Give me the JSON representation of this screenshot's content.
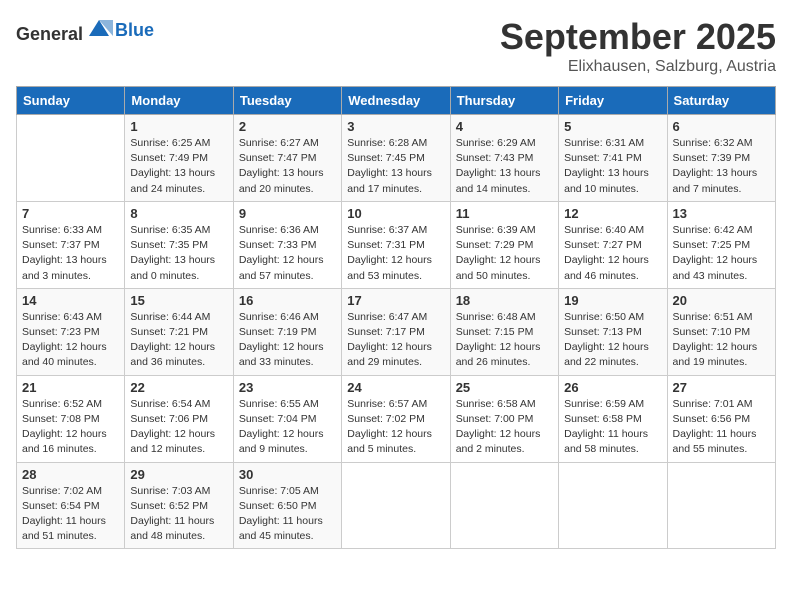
{
  "header": {
    "logo_general": "General",
    "logo_blue": "Blue",
    "month": "September 2025",
    "location": "Elixhausen, Salzburg, Austria"
  },
  "weekdays": [
    "Sunday",
    "Monday",
    "Tuesday",
    "Wednesday",
    "Thursday",
    "Friday",
    "Saturday"
  ],
  "weeks": [
    [
      {
        "day": "",
        "info": ""
      },
      {
        "day": "1",
        "info": "Sunrise: 6:25 AM\nSunset: 7:49 PM\nDaylight: 13 hours\nand 24 minutes."
      },
      {
        "day": "2",
        "info": "Sunrise: 6:27 AM\nSunset: 7:47 PM\nDaylight: 13 hours\nand 20 minutes."
      },
      {
        "day": "3",
        "info": "Sunrise: 6:28 AM\nSunset: 7:45 PM\nDaylight: 13 hours\nand 17 minutes."
      },
      {
        "day": "4",
        "info": "Sunrise: 6:29 AM\nSunset: 7:43 PM\nDaylight: 13 hours\nand 14 minutes."
      },
      {
        "day": "5",
        "info": "Sunrise: 6:31 AM\nSunset: 7:41 PM\nDaylight: 13 hours\nand 10 minutes."
      },
      {
        "day": "6",
        "info": "Sunrise: 6:32 AM\nSunset: 7:39 PM\nDaylight: 13 hours\nand 7 minutes."
      }
    ],
    [
      {
        "day": "7",
        "info": "Sunrise: 6:33 AM\nSunset: 7:37 PM\nDaylight: 13 hours\nand 3 minutes."
      },
      {
        "day": "8",
        "info": "Sunrise: 6:35 AM\nSunset: 7:35 PM\nDaylight: 13 hours\nand 0 minutes."
      },
      {
        "day": "9",
        "info": "Sunrise: 6:36 AM\nSunset: 7:33 PM\nDaylight: 12 hours\nand 57 minutes."
      },
      {
        "day": "10",
        "info": "Sunrise: 6:37 AM\nSunset: 7:31 PM\nDaylight: 12 hours\nand 53 minutes."
      },
      {
        "day": "11",
        "info": "Sunrise: 6:39 AM\nSunset: 7:29 PM\nDaylight: 12 hours\nand 50 minutes."
      },
      {
        "day": "12",
        "info": "Sunrise: 6:40 AM\nSunset: 7:27 PM\nDaylight: 12 hours\nand 46 minutes."
      },
      {
        "day": "13",
        "info": "Sunrise: 6:42 AM\nSunset: 7:25 PM\nDaylight: 12 hours\nand 43 minutes."
      }
    ],
    [
      {
        "day": "14",
        "info": "Sunrise: 6:43 AM\nSunset: 7:23 PM\nDaylight: 12 hours\nand 40 minutes."
      },
      {
        "day": "15",
        "info": "Sunrise: 6:44 AM\nSunset: 7:21 PM\nDaylight: 12 hours\nand 36 minutes."
      },
      {
        "day": "16",
        "info": "Sunrise: 6:46 AM\nSunset: 7:19 PM\nDaylight: 12 hours\nand 33 minutes."
      },
      {
        "day": "17",
        "info": "Sunrise: 6:47 AM\nSunset: 7:17 PM\nDaylight: 12 hours\nand 29 minutes."
      },
      {
        "day": "18",
        "info": "Sunrise: 6:48 AM\nSunset: 7:15 PM\nDaylight: 12 hours\nand 26 minutes."
      },
      {
        "day": "19",
        "info": "Sunrise: 6:50 AM\nSunset: 7:13 PM\nDaylight: 12 hours\nand 22 minutes."
      },
      {
        "day": "20",
        "info": "Sunrise: 6:51 AM\nSunset: 7:10 PM\nDaylight: 12 hours\nand 19 minutes."
      }
    ],
    [
      {
        "day": "21",
        "info": "Sunrise: 6:52 AM\nSunset: 7:08 PM\nDaylight: 12 hours\nand 16 minutes."
      },
      {
        "day": "22",
        "info": "Sunrise: 6:54 AM\nSunset: 7:06 PM\nDaylight: 12 hours\nand 12 minutes."
      },
      {
        "day": "23",
        "info": "Sunrise: 6:55 AM\nSunset: 7:04 PM\nDaylight: 12 hours\nand 9 minutes."
      },
      {
        "day": "24",
        "info": "Sunrise: 6:57 AM\nSunset: 7:02 PM\nDaylight: 12 hours\nand 5 minutes."
      },
      {
        "day": "25",
        "info": "Sunrise: 6:58 AM\nSunset: 7:00 PM\nDaylight: 12 hours\nand 2 minutes."
      },
      {
        "day": "26",
        "info": "Sunrise: 6:59 AM\nSunset: 6:58 PM\nDaylight: 11 hours\nand 58 minutes."
      },
      {
        "day": "27",
        "info": "Sunrise: 7:01 AM\nSunset: 6:56 PM\nDaylight: 11 hours\nand 55 minutes."
      }
    ],
    [
      {
        "day": "28",
        "info": "Sunrise: 7:02 AM\nSunset: 6:54 PM\nDaylight: 11 hours\nand 51 minutes."
      },
      {
        "day": "29",
        "info": "Sunrise: 7:03 AM\nSunset: 6:52 PM\nDaylight: 11 hours\nand 48 minutes."
      },
      {
        "day": "30",
        "info": "Sunrise: 7:05 AM\nSunset: 6:50 PM\nDaylight: 11 hours\nand 45 minutes."
      },
      {
        "day": "",
        "info": ""
      },
      {
        "day": "",
        "info": ""
      },
      {
        "day": "",
        "info": ""
      },
      {
        "day": "",
        "info": ""
      }
    ]
  ]
}
